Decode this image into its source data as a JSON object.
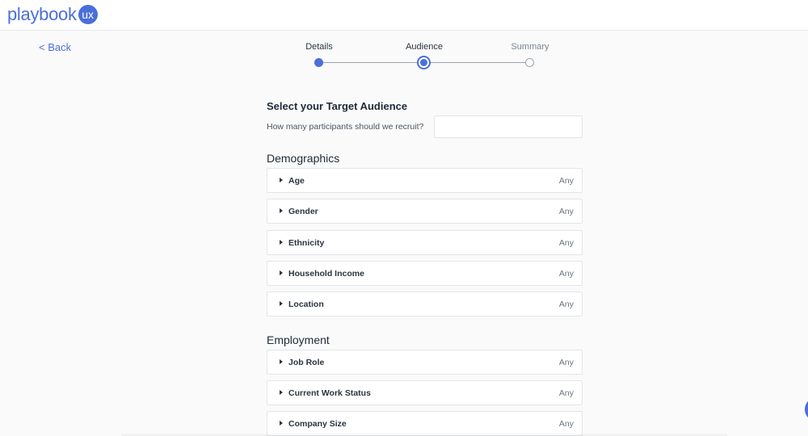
{
  "header": {
    "logo_text": "playbook",
    "logo_badge": "ux"
  },
  "nav": {
    "back_label": "< Back"
  },
  "stepper": {
    "steps": [
      {
        "label": "Details",
        "state": "done"
      },
      {
        "label": "Audience",
        "state": "current"
      },
      {
        "label": "Summary",
        "state": "upcoming"
      }
    ]
  },
  "form": {
    "title": "Select your Target Audience",
    "participants_question": "How many participants should we recruit?",
    "participants_value": ""
  },
  "demographics": {
    "title": "Demographics",
    "items": [
      {
        "label": "Age",
        "value": "Any"
      },
      {
        "label": "Gender",
        "value": "Any"
      },
      {
        "label": "Ethnicity",
        "value": "Any"
      },
      {
        "label": "Household Income",
        "value": "Any"
      },
      {
        "label": "Location",
        "value": "Any"
      }
    ]
  },
  "employment": {
    "title": "Employment",
    "items": [
      {
        "label": "Job Role",
        "value": "Any"
      },
      {
        "label": "Current Work Status",
        "value": "Any"
      },
      {
        "label": "Company Size",
        "value": "Any"
      }
    ]
  },
  "colors": {
    "accent": "#4a6fd8",
    "text": "#1f2a37",
    "muted": "#6b7280",
    "background": "#fafafa"
  },
  "icons": {
    "expand": "caret-right-icon"
  }
}
